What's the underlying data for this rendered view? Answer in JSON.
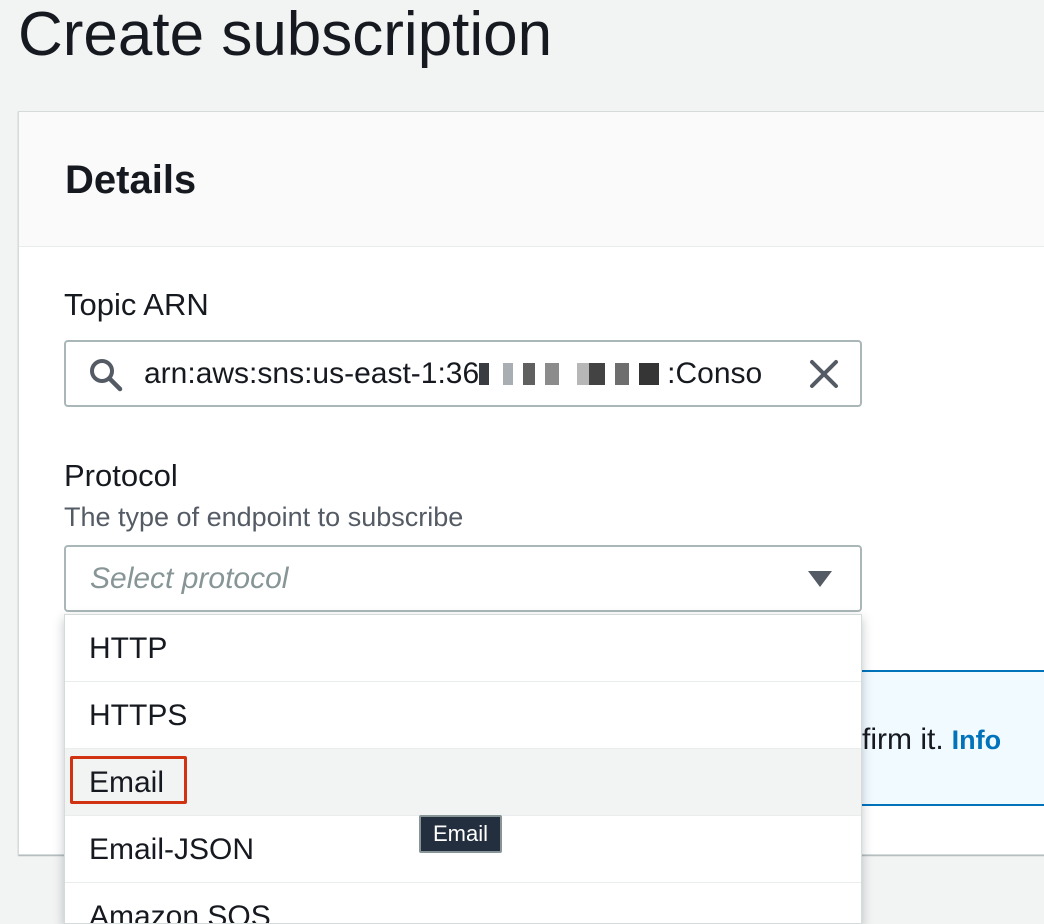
{
  "page": {
    "title": "Create subscription"
  },
  "details": {
    "heading": "Details",
    "topic_arn": {
      "label": "Topic ARN",
      "value_prefix": "arn:aws:sns:us-east-1:36",
      "value_suffix": ":Conso",
      "search_icon": "search-icon",
      "clear_icon": "close-icon"
    },
    "protocol": {
      "label": "Protocol",
      "description": "The type of endpoint to subscribe",
      "placeholder": "Select protocol",
      "caret_icon": "caret-down-icon",
      "options": [
        {
          "label": "HTTP"
        },
        {
          "label": "HTTPS"
        },
        {
          "label": "Email"
        },
        {
          "label": "Email-JSON"
        },
        {
          "label": "Amazon SQS"
        }
      ],
      "highlighted_option": "Email"
    },
    "alert": {
      "text": "firm it.",
      "link": "Info"
    }
  },
  "tooltip": {
    "text": "Email"
  },
  "colors": {
    "link": "#0073bb",
    "highlight_border": "#d13212",
    "tooltip_bg": "#232f3e"
  }
}
